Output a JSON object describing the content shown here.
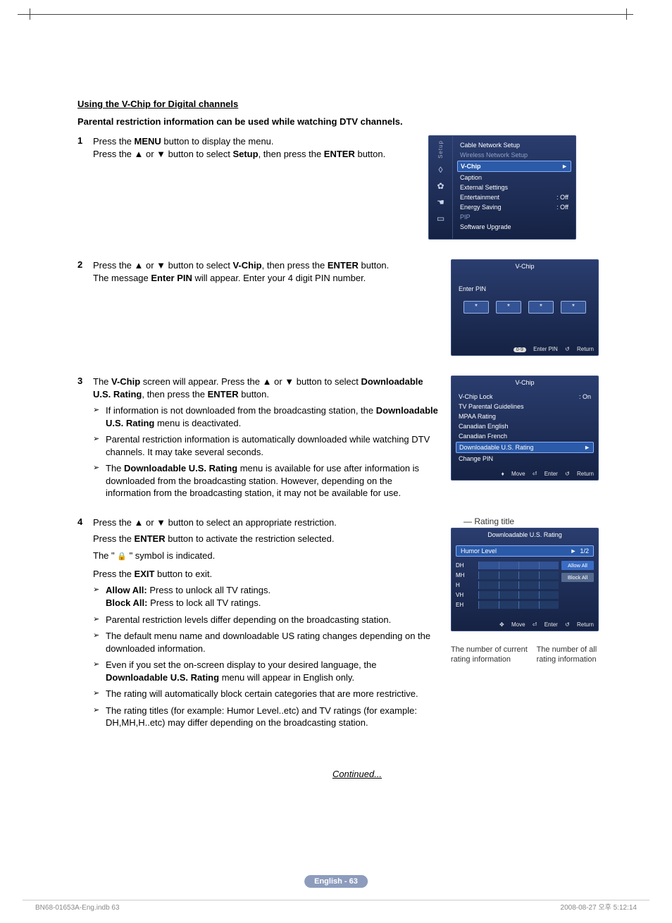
{
  "section_title": "Using the V-Chip for Digital channels",
  "intro": "Parental restriction information can be used while watching DTV channels.",
  "steps": {
    "s1": {
      "num": "1",
      "p1a": "Press the ",
      "p1b": "MENU",
      "p1c": " button to display the menu.",
      "p2a": "Press the ▲ or ▼ button to select ",
      "p2b": "Setup",
      "p2c": ", then press the ",
      "p2d": "ENTER",
      "p2e": " button."
    },
    "s2": {
      "num": "2",
      "p1a": "Press the ▲ or ▼ button to select ",
      "p1b": "V-Chip",
      "p1c": ", then press the ",
      "p1d": "ENTER",
      "p1e": " button.",
      "p2a": "The message ",
      "p2b": "Enter PIN",
      "p2c": " will appear. Enter your 4 digit PIN number."
    },
    "s3": {
      "num": "3",
      "p1a": "The ",
      "p1b": "V-Chip",
      "p1c": " screen will appear. Press the ▲ or ▼ button to select ",
      "p1d": "Downloadable U.S. Rating",
      "p1e": ", then press the ",
      "p1f": "ENTER",
      "p1g": " button.",
      "b1a": "If information is not downloaded from the broadcasting station, the ",
      "b1b": "Downloadable U.S. Rating",
      "b1c": " menu is deactivated.",
      "b2": "Parental restriction information is automatically downloaded while watching DTV channels. It may take several seconds.",
      "b3a": "The ",
      "b3b": "Downloadable U.S. Rating",
      "b3c": " menu is available for use after information is downloaded from the broadcasting station. However, depending on the information from the broadcasting station, it may not be available for use."
    },
    "s4": {
      "num": "4",
      "p1": "Press the ▲ or ▼ button to select an appropriate restriction.",
      "p2a": "Press the ",
      "p2b": "ENTER",
      "p2c": " button to activate the restriction selected.",
      "p3a": "The \" ",
      "p3b": " \" symbol is indicated.",
      "p4a": "Press the ",
      "p4b": "EXIT",
      "p4c": " button to exit.",
      "b1a": "Allow All:",
      "b1b": " Press to unlock all TV ratings.",
      "b1c": "Block All:",
      "b1d": " Press to lock all TV ratings.",
      "b2": "Parental restriction levels differ depending on the broadcasting station.",
      "b3": "The default menu name and downloadable US rating changes depending on the downloaded information.",
      "b4a": "Even if you set the on-screen display to your desired language, the ",
      "b4b": "Downloadable U.S. Rating",
      "b4c": " menu will appear in English only.",
      "b5": "The rating will automatically block certain categories that are more restrictive.",
      "b6": "The rating titles (for example: Humor Level..etc) and TV ratings (for example: DH,MH,H..etc) may differ depending on the broadcasting station."
    }
  },
  "osd": {
    "setup": {
      "tab": "Setup",
      "items": {
        "cable": "Cable Network Setup",
        "wireless": "Wireless Network Setup",
        "vchip": "V-Chip",
        "caption": "Caption",
        "external": "External Settings",
        "entertainment": "Entertainment",
        "entertainment_val": ": Off",
        "energy": "Energy Saving",
        "energy_val": ": Off",
        "pip": "PIP",
        "software": "Software Upgrade"
      }
    },
    "pin": {
      "title": "V-Chip",
      "enter": "Enter PIN",
      "box": "*",
      "foot_enter": "Enter PIN",
      "foot_key": "0-9",
      "foot_return": "Return"
    },
    "vchip": {
      "title": "V-Chip",
      "lock": "V-Chip Lock",
      "lock_val": ": On",
      "tv": "TV Parental Guidelines",
      "mpaa": "MPAA Rating",
      "can_en": "Canadian English",
      "can_fr": "Canadian French",
      "dl": "Downloadable U.S. Rating",
      "change": "Change PIN",
      "foot_move": "Move",
      "foot_enter": "Enter",
      "foot_return": "Return"
    },
    "download": {
      "title_label": "Rating title",
      "title": "Downloadable U.S. Rating",
      "humor": "Humor Level",
      "page": "1/2",
      "rows": {
        "r1": "DH",
        "r2": "MH",
        "r3": "H",
        "r4": "VH",
        "r5": "EH"
      },
      "allow": "Allow All",
      "block": "Block All",
      "foot_move": "Move",
      "foot_enter": "Enter",
      "foot_return": "Return",
      "annot_left": "The number of current rating information",
      "annot_right": "The number of all rating information"
    }
  },
  "continued": "Continued...",
  "badge": "English - 63",
  "footer_left": "BN68-01653A-Eng.indb   63",
  "footer_right": "2008-08-27   오후 5:12:14"
}
